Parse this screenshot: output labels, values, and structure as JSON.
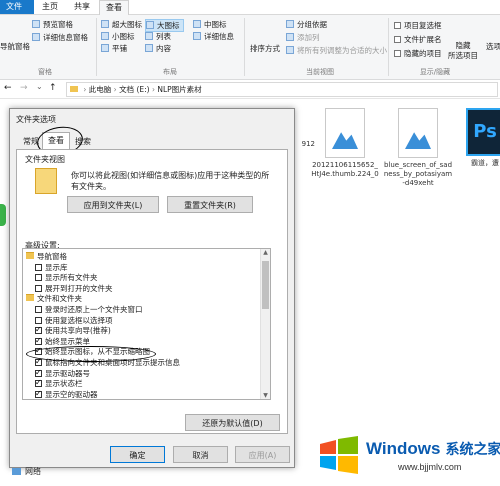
{
  "ribbon": {
    "tabs": [
      "文件",
      "主页",
      "共享",
      "查看"
    ],
    "pane_group": {
      "nav_pane_label": "导航窗格",
      "preview_pane": "预览窗格",
      "details_pane": "详细信息窗格",
      "group_label": "窗格"
    },
    "layout_group": {
      "items": [
        "超大图标",
        "大图标",
        "中图标",
        "小图标",
        "列表",
        "详细信息",
        "平铺",
        "内容"
      ],
      "group_label": "布局"
    },
    "current_view_group": {
      "sort_label": "排序方式",
      "group_by": "分组依据",
      "add_column": "添加列",
      "size_all_columns": "将所有列调整为合适的大小",
      "group_label": "当前视图"
    },
    "show_hide_group": {
      "item_checkboxes": "项目复选框",
      "file_extensions": "文件扩展名",
      "hidden_items": "隐藏的项目",
      "hide_selected": "隐藏\n所选项目",
      "group_label": "显示/隐藏"
    },
    "options_label": "选项"
  },
  "address": {
    "path": [
      "此电脑",
      "文档 (E:)",
      "NLP图片素材"
    ]
  },
  "files": [
    {
      "name": "912",
      "kind": "partial"
    },
    {
      "name": "20121106115652_HtJ4e.thumb.224_0",
      "kind": "image"
    },
    {
      "name": "blue_screen_of_sadness_by_potasiyam-d49xeht",
      "kind": "image"
    },
    {
      "name": "霸道，遭",
      "kind": "ps"
    }
  ],
  "dialog": {
    "title": "文件夹选项",
    "tabs": [
      "常规",
      "查看",
      "搜索"
    ],
    "folder_views": {
      "heading": "文件夹视图",
      "description": "你可以将此视图(如详细信息或图标)应用于这种类型的所有文件夹。",
      "apply_button": "应用到文件夹(L)",
      "reset_button": "重置文件夹(R)"
    },
    "advanced_label": "高级设置:",
    "tree": [
      {
        "text": "导航窗格",
        "type": "folder",
        "level": 0
      },
      {
        "text": "显示库",
        "type": "check",
        "checked": false,
        "level": 1
      },
      {
        "text": "显示所有文件夹",
        "type": "check",
        "checked": false,
        "level": 1
      },
      {
        "text": "展开到打开的文件夹",
        "type": "check",
        "checked": false,
        "level": 1
      },
      {
        "text": "文件和文件夹",
        "type": "folder",
        "level": 0
      },
      {
        "text": "登录时还原上一个文件夹窗口",
        "type": "check",
        "checked": false,
        "level": 1
      },
      {
        "text": "使用复选框以选择项",
        "type": "check",
        "checked": false,
        "level": 1
      },
      {
        "text": "使用共享向导(推荐)",
        "type": "check",
        "checked": true,
        "level": 1
      },
      {
        "text": "始终显示菜单",
        "type": "check",
        "checked": true,
        "level": 1
      },
      {
        "text": "始终显示图标，从不显示缩略图",
        "type": "check",
        "checked": true,
        "level": 1
      },
      {
        "text": "鼠标指向文件夹和桌面项时显示提示信息",
        "type": "check",
        "checked": true,
        "level": 1
      },
      {
        "text": "显示驱动器号",
        "type": "check",
        "checked": true,
        "level": 1
      },
      {
        "text": "显示状态栏",
        "type": "check",
        "checked": true,
        "level": 1
      },
      {
        "text": "显示空的驱动器",
        "type": "check",
        "checked": true,
        "level": 1
      }
    ],
    "restore_defaults": "还原为默认值(D)",
    "ok": "确定",
    "cancel": "取消",
    "apply": "应用(A)"
  },
  "nav": {
    "network": "网络"
  },
  "watermark": {
    "brand": "Windows",
    "brand_cn": "系统之家",
    "url": "www.bjjmlv.com"
  },
  "colors": {
    "accent": "#1979ca",
    "watermark": "#0a5bb0",
    "ps_blue": "#31a8ff"
  }
}
